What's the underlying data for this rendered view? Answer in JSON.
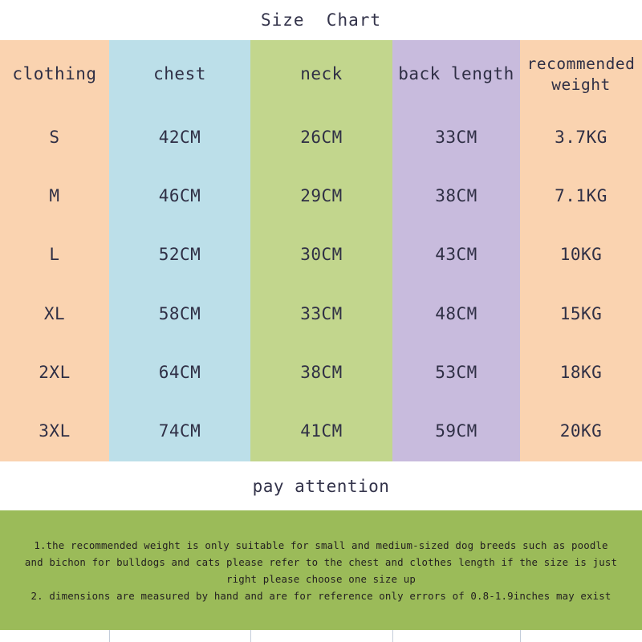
{
  "title": "Size  Chart",
  "colors": {
    "col_clothing": "#fad3b0",
    "col_chest": "#bcdfe9",
    "col_neck": "#c2d68d",
    "col_back_length": "#c8bbdd",
    "col_recommended_weight": "#fad3b0",
    "notes_background": "#9bbb59",
    "text": "#2f2f45",
    "page_background": "#ffffff"
  },
  "table": {
    "headers": [
      "clothing",
      "chest",
      "neck",
      "back length",
      "recommended\nweight"
    ],
    "rows": [
      {
        "clothing": "S",
        "chest": "42CM",
        "neck": "26CM",
        "back_length": "33CM",
        "recommended_weight": "3.7KG"
      },
      {
        "clothing": "M",
        "chest": "46CM",
        "neck": "29CM",
        "back_length": "38CM",
        "recommended_weight": "7.1KG"
      },
      {
        "clothing": "L",
        "chest": "52CM",
        "neck": "30CM",
        "back_length": "43CM",
        "recommended_weight": "10KG"
      },
      {
        "clothing": "XL",
        "chest": "58CM",
        "neck": "33CM",
        "back_length": "48CM",
        "recommended_weight": "15KG"
      },
      {
        "clothing": "2XL",
        "chest": "64CM",
        "neck": "38CM",
        "back_length": "53CM",
        "recommended_weight": "18KG"
      },
      {
        "clothing": "3XL",
        "chest": "74CM",
        "neck": "41CM",
        "back_length": "59CM",
        "recommended_weight": "20KG"
      }
    ]
  },
  "attention": {
    "heading": "pay attention",
    "lines": [
      "1.the recommended weight is only suitable for small and medium-sized dog breeds such as poodle",
      "and bichon for bulldogs and cats please refer to the chest and clothes length if the size is just",
      "right please choose one size up",
      "2. dimensions are measured by hand and are for reference only errors of 0.8-1.9inches may exist"
    ]
  },
  "chart_data": {
    "type": "table",
    "title": "Size  Chart",
    "columns": [
      "clothing",
      "chest",
      "neck",
      "back length",
      "recommended weight"
    ],
    "rows": [
      [
        "S",
        "42CM",
        "26CM",
        "33CM",
        "3.7KG"
      ],
      [
        "M",
        "46CM",
        "29CM",
        "38CM",
        "7.1KG"
      ],
      [
        "L",
        "52CM",
        "30CM",
        "43CM",
        "10KG"
      ],
      [
        "XL",
        "58CM",
        "33CM",
        "48CM",
        "15KG"
      ],
      [
        "2XL",
        "64CM",
        "38CM",
        "53CM",
        "18KG"
      ],
      [
        "3XL",
        "74CM",
        "41CM",
        "59CM",
        "20KG"
      ]
    ],
    "units": {
      "chest": "CM",
      "neck": "CM",
      "back length": "CM",
      "recommended weight": "KG"
    },
    "numeric": {
      "sizes": [
        "S",
        "M",
        "L",
        "XL",
        "2XL",
        "3XL"
      ],
      "chest_cm": [
        42,
        46,
        52,
        58,
        64,
        74
      ],
      "neck_cm": [
        26,
        29,
        30,
        33,
        38,
        41
      ],
      "back_length_cm": [
        33,
        38,
        43,
        48,
        53,
        59
      ],
      "recommended_weight_kg": [
        3.7,
        7.1,
        10,
        15,
        18,
        20
      ]
    }
  }
}
